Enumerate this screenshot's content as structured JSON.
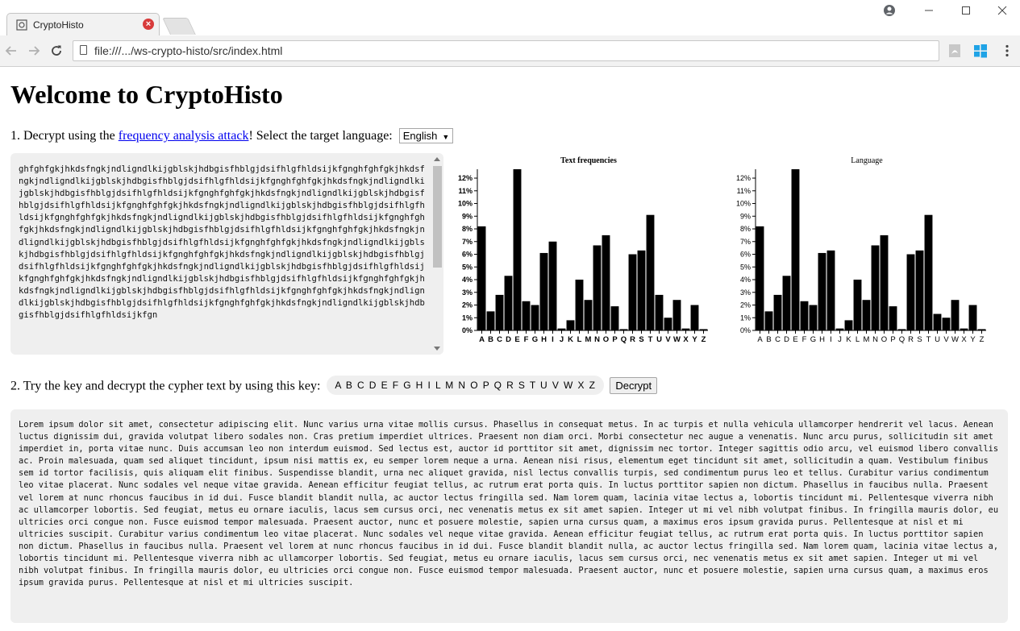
{
  "browser": {
    "tab_title": "CryptoHisto",
    "url": "file:///.../ws-crypto-histo/src/index.html"
  },
  "page": {
    "title": "Welcome to CryptoHisto",
    "step1": {
      "prefix": "1. Decrypt using the ",
      "link": "frequency analysis attack",
      "suffix": "! Select the target language:",
      "language": "English"
    },
    "step2": {
      "prefix": "2. Try the key and decrypt the cypher text by using this key:",
      "key": "A B C D E F G H I L M N O P Q R S T U V W X Z",
      "button": "Decrypt"
    },
    "cipher_text": "ghfghfgkjhkdsfngkjndligndlkijgblskjhdbgisfhblgjdsifhlgfhldsijkfgnghfghfgkjhkdsfngkjndligndlkijgblskjhdbgisfhblgjdsifhlgfhldsijkfgnghfghfgkjhkdsfngkjndligndlkijgblskjhdbgisfhblgjdsifhlgfhldsijkfgnghfghfgkjhkdsfngkjndligndlkijgblskjhdbgisfhblgjdsifhlgfhldsijkfgnghfghfgkjhkdsfngkjndligndlkijgblskjhdbgisfhblgjdsifhlgfhldsijkfgnghfghfgkjhkdsfngkjndligndlkijgblskjhdbgisfhblgjdsifhlgfhldsijkfgnghfghfgkjhkdsfngkjndligndlkijgblskjhdbgisfhblgjdsifhlgfhldsijkfgnghfghfgkjhkdsfngkjndligndlkijgblskjhdbgisfhblgjdsifhlgfhldsijkfgnghfghfgkjhkdsfngkjndligndlkijgblskjhdbgisfhblgjdsifhlgfhldsijkfgnghfghfgkjhkdsfngkjndligndlkijgblskjhdbgisfhblgjdsifhlgfhldsijkfgnghfghfgkjhkdsfngkjndligndlkijgblskjhdbgisfhblgjdsifhlgfhldsijkfgnghfghfgkjhkdsfngkjndligndlkijgblskjhdbgisfhblgjdsifhlgfhldsijkfgnghfghfgkjhkdsfngkjndligndlkijgblskjhdbgisfhblgjdsifhlgfhldsijkfgnghfghfgkjhkdsfngkjndligndlkijgblskjhdbgisfhblgjdsifhlgfhldsijkfgnghfghfgkjhkdsfngkjndligndlkijgblskjhdbgisfhblgjdsifhlgfhldsijkfgn",
    "plain_text": "Lorem ipsum dolor sit amet, consectetur adipiscing elit. Nunc varius urna vitae mollis cursus. Phasellus in consequat metus. In ac turpis et nulla vehicula ullamcorper hendrerit vel lacus. Aenean luctus dignissim dui, gravida volutpat libero sodales non. Cras pretium imperdiet ultrices. Praesent non diam orci. Morbi consectetur nec augue a venenatis. Nunc arcu purus, sollicitudin sit amet imperdiet in, porta vitae nunc. Duis accumsan leo non interdum euismod. Sed lectus est, auctor id porttitor sit amet, dignissim nec tortor. Integer sagittis odio arcu, vel euismod libero convallis ac. Proin malesuada, quam sed aliquet tincidunt, ipsum nisi mattis ex, eu semper lorem neque a urna. Aenean nisi risus, elementum eget tincidunt sit amet, sollicitudin a quam. Vestibulum finibus sem id tortor facilisis, quis aliquam elit finibus. Suspendisse blandit, urna nec aliquet gravida, nisl lectus convallis turpis, sed condimentum purus leo et tellus. Curabitur varius condimentum leo vitae placerat. Nunc sodales vel neque vitae gravida. Aenean efficitur feugiat tellus, ac rutrum erat porta quis. In luctus porttitor sapien non dictum. Phasellus in faucibus nulla. Praesent vel lorem at nunc rhoncus faucibus in id dui. Fusce blandit blandit nulla, ac auctor lectus fringilla sed. Nam lorem quam, lacinia vitae lectus a, lobortis tincidunt mi. Pellentesque viverra nibh ac ullamcorper lobortis. Sed feugiat, metus eu ornare iaculis, lacus sem cursus orci, nec venenatis metus ex sit amet sapien. Integer ut mi vel nibh volutpat finibus. In fringilla mauris dolor, eu ultricies orci congue non. Fusce euismod tempor malesuada. Praesent auctor, nunc et posuere molestie, sapien urna cursus quam, a maximus eros ipsum gravida purus. Pellentesque at nisl et mi ultricies suscipit. Curabitur varius condimentum leo vitae placerat. Nunc sodales vel neque vitae gravida. Aenean efficitur feugiat tellus, ac rutrum erat porta quis. In luctus porttitor sapien non dictum. Phasellus in faucibus nulla. Praesent vel lorem at nunc rhoncus faucibus in id dui. Fusce blandit blandit nulla, ac auctor lectus fringilla sed. Nam lorem quam, lacinia vitae lectus a, lobortis tincidunt mi. Pellentesque viverra nibh ac ullamcorper lobortis. Sed feugiat, metus eu ornare iaculis, lacus sem cursus orci, nec venenatis metus ex sit amet sapien. Integer ut mi vel nibh volutpat finibus. In fringilla mauris dolor, eu ultricies orci congue non. Fusce euismod tempor malesuada. Praesent auctor, nunc et posuere molestie, sapien urna cursus quam, a maximus eros ipsum gravida purus. Pellentesque at nisl et mi ultricies suscipit."
  },
  "icons": {
    "back": "arrow-left-icon",
    "forward": "arrow-right-icon",
    "reload": "reload-icon",
    "account": "account-icon",
    "pdf": "pdf-extension-icon",
    "windows": "windows-extension-icon",
    "menu": "kebab-menu-icon"
  },
  "chart_data": [
    {
      "type": "bar",
      "title": "Text frequencies",
      "categories": [
        "A",
        "B",
        "C",
        "D",
        "E",
        "F",
        "G",
        "H",
        "I",
        "J",
        "K",
        "L",
        "M",
        "N",
        "O",
        "P",
        "Q",
        "R",
        "S",
        "T",
        "U",
        "V",
        "W",
        "X",
        "Y",
        "Z"
      ],
      "values": [
        8.2,
        1.5,
        2.8,
        4.3,
        12.7,
        2.3,
        2.0,
        6.1,
        7.0,
        0.15,
        0.8,
        4.0,
        2.4,
        6.7,
        7.5,
        1.9,
        0.1,
        6.0,
        6.3,
        9.1,
        2.8,
        1.0,
        2.4,
        0.15,
        2.0,
        0.1
      ],
      "ylim": [
        0,
        12.7
      ],
      "yticks": [
        "0%",
        "1%",
        "2%",
        "3%",
        "4%",
        "5%",
        "6%",
        "7%",
        "8%",
        "9%",
        "10%",
        "11%",
        "12%"
      ],
      "bold_labels": true,
      "color": "#000000"
    },
    {
      "type": "bar",
      "title": "Language",
      "categories": [
        "A",
        "B",
        "C",
        "D",
        "E",
        "F",
        "G",
        "H",
        "I",
        "J",
        "K",
        "L",
        "M",
        "N",
        "O",
        "P",
        "Q",
        "R",
        "S",
        "T",
        "U",
        "V",
        "W",
        "X",
        "Y",
        "Z"
      ],
      "values": [
        8.2,
        1.5,
        2.8,
        4.3,
        12.7,
        2.3,
        2.0,
        6.1,
        6.3,
        0.15,
        0.8,
        4.0,
        2.4,
        6.7,
        7.5,
        1.9,
        0.1,
        6.0,
        6.3,
        9.1,
        1.3,
        1.0,
        2.4,
        0.15,
        2.0,
        0.1
      ],
      "ylim": [
        0,
        12.7
      ],
      "yticks": [
        "0%",
        "1%",
        "2%",
        "3%",
        "4%",
        "5%",
        "6%",
        "7%",
        "8%",
        "9%",
        "10%",
        "11%",
        "12%"
      ],
      "bold_labels": false,
      "color": "#000000"
    }
  ]
}
